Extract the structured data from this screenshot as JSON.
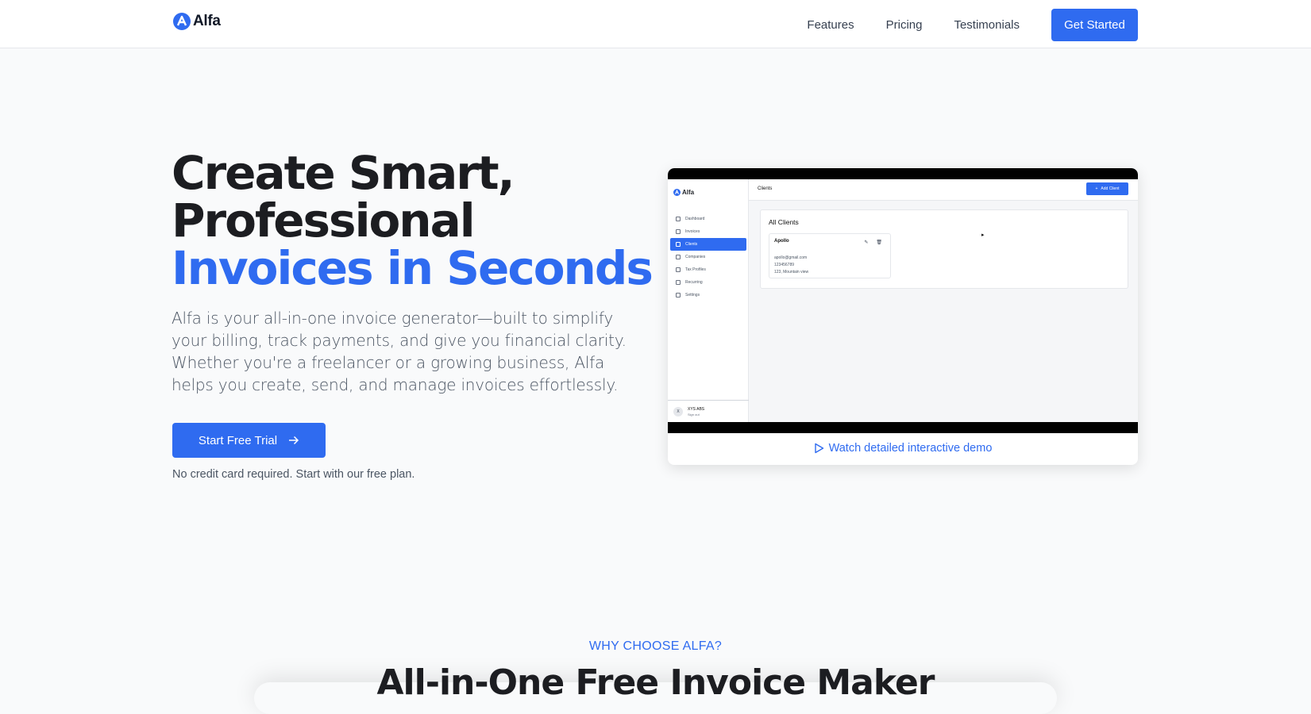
{
  "nav": {
    "brand": "Alfa",
    "links": [
      "Features",
      "Pricing",
      "Testimonials"
    ],
    "cta": "Get Started"
  },
  "hero": {
    "title_line1": "Create Smart,",
    "title_line2": "Professional",
    "title_accent": "Invoices in Seconds",
    "description": "Alfa is your all-in-one invoice generator—built to simplify your billing, track payments, and give you financial clarity. Whether you're a freelancer or a growing business, Alfa helps you create, send, and manage invoices effortlessly.",
    "cta": "Start Free Trial",
    "note": "No credit card required. Start with our free plan."
  },
  "preview": {
    "brand": "Alfa",
    "nav_items": [
      "Dashboard",
      "Invoices",
      "Clients",
      "Companies",
      "Tax Profiles",
      "Recurring",
      "Settings"
    ],
    "active_item": "Clients",
    "page_title": "Clients",
    "add_button": "Add Client",
    "card_title": "All Clients",
    "client": {
      "name": "Apollo",
      "email": "apollo@gmail.com",
      "phone": "123456789",
      "address": "123, Mountain view"
    },
    "user_initial": "X",
    "user_name": "XYS ABS",
    "user_action": "Sign out",
    "demo_link": "Watch detailed interactive demo"
  },
  "why": {
    "label": "WHY CHOOSE ALFA?",
    "title": "All-in-One Free Invoice Maker"
  },
  "colors": {
    "accent": "#2f6bf0",
    "heading": "#1c1d21",
    "body_text": "#4b5563"
  }
}
